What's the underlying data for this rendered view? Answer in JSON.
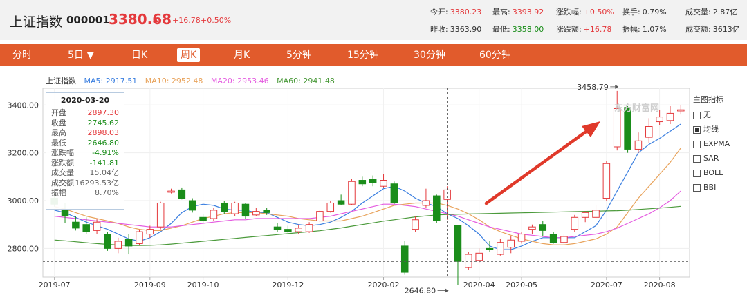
{
  "header": {
    "name": "上证指数",
    "code": "000001",
    "price": "3380.68",
    "change": "+16.78",
    "change_pct": "+0.50%",
    "stats": [
      {
        "label": "今开:",
        "value": "3380.23",
        "color": "red"
      },
      {
        "label": "最高:",
        "value": "3393.92",
        "color": "red"
      },
      {
        "label": "涨跌幅:",
        "value": "+0.50%",
        "color": "red"
      },
      {
        "label": "换手:",
        "value": "0.79%",
        "color": "dark"
      },
      {
        "label": "成交量:",
        "value": "2.87亿",
        "color": "dark"
      },
      {
        "label": "昨收:",
        "value": "3363.90",
        "color": "dark"
      },
      {
        "label": "最低:",
        "value": "3358.00",
        "color": "green"
      },
      {
        "label": "涨跌额:",
        "value": "+16.78",
        "color": "red"
      },
      {
        "label": "振幅:",
        "value": "1.07%",
        "color": "dark"
      },
      {
        "label": "成交额:",
        "value": "3613亿",
        "color": "dark"
      }
    ]
  },
  "tabs": [
    {
      "label": "分时",
      "active": false
    },
    {
      "label": "5日 ▼",
      "active": false
    },
    {
      "label": "日K",
      "active": false
    },
    {
      "label": "周K",
      "active": true
    },
    {
      "label": "月K",
      "active": false
    },
    {
      "label": "5分钟",
      "active": false
    },
    {
      "label": "15分钟",
      "active": false
    },
    {
      "label": "30分钟",
      "active": false
    },
    {
      "label": "60分钟",
      "active": false
    }
  ],
  "legend": {
    "name": "上证指数",
    "ma5": "MA5: 2917.51",
    "ma10": "MA10: 2952.48",
    "ma20": "MA20: 2953.46",
    "ma60": "MA60: 2941.48"
  },
  "tooltip": {
    "date": "2020-03-20",
    "rows": [
      {
        "label": "开盘",
        "value": "2897.30",
        "color": "red"
      },
      {
        "label": "收盘",
        "value": "2745.62",
        "color": "green"
      },
      {
        "label": "最高",
        "value": "2898.03",
        "color": "red"
      },
      {
        "label": "最低",
        "value": "2646.80",
        "color": "green"
      },
      {
        "label": "涨跌幅",
        "value": "-4.91%",
        "color": "green"
      },
      {
        "label": "涨跌额",
        "value": "-141.81",
        "color": "green"
      },
      {
        "label": "成交量",
        "value": "15.04亿",
        "color": "gray"
      },
      {
        "label": "成交额",
        "value": "16293.53亿",
        "color": "gray"
      },
      {
        "label": "振幅",
        "value": "8.70%",
        "color": "gray"
      }
    ]
  },
  "side_panel": {
    "title": "主图指标",
    "options": [
      {
        "label": "无",
        "checked": false
      },
      {
        "label": "均线",
        "checked": true
      },
      {
        "label": "EXPMA",
        "checked": false
      },
      {
        "label": "SAR",
        "checked": false
      },
      {
        "label": "BOLL",
        "checked": false
      },
      {
        "label": "BBI",
        "checked": false
      }
    ]
  },
  "watermark": "东方财富网",
  "colors": {
    "up": "#e4393c",
    "down": "#1a8d1a",
    "accent": "#e15b2c",
    "ma5": "#3b7fe0",
    "ma10": "#e8a25a",
    "ma20": "#e45be0",
    "ma60": "#4b9a3b"
  },
  "chart_data": {
    "type": "candlestick",
    "ylim": [
      2680,
      3470
    ],
    "yticks": [
      "3400.00",
      "3200.00",
      "3000.00",
      "2800.00"
    ],
    "ytick_values": [
      3400,
      3200,
      3000,
      2800
    ],
    "xtick_labels": [
      "2019-07",
      "2019-09",
      "2019-10",
      "2019-12",
      "2020-02",
      "2020-04",
      "2020-05",
      "2020-07",
      "2020-08"
    ],
    "xtick_index": [
      0,
      9,
      14,
      22,
      31,
      40,
      44,
      52,
      57
    ],
    "annotations": [
      {
        "text": "3458.79",
        "index": 53,
        "value": 3458.79
      },
      {
        "text": "2646.80",
        "index": 37,
        "value": 2646.8
      }
    ],
    "crosshair": {
      "index": 37,
      "value": 2745.62
    },
    "candles": [
      [
        3010,
        2985,
        3040,
        2975
      ],
      [
        2960,
        2935,
        2990,
        2905
      ],
      [
        2910,
        2885,
        2935,
        2875
      ],
      [
        2900,
        2870,
        2930,
        2860
      ],
      [
        2875,
        2910,
        2925,
        2860
      ],
      [
        2860,
        2800,
        2870,
        2790
      ],
      [
        2800,
        2830,
        2845,
        2780
      ],
      [
        2840,
        2810,
        2860,
        2775
      ],
      [
        2820,
        2870,
        2880,
        2815
      ],
      [
        2860,
        2880,
        2895,
        2845
      ],
      [
        2890,
        2990,
        2995,
        2880
      ],
      [
        3035,
        3040,
        3050,
        3030
      ],
      [
        3045,
        3010,
        3055,
        3005
      ],
      [
        3000,
        2960,
        3010,
        2950
      ],
      [
        2930,
        2915,
        2945,
        2905
      ],
      [
        2925,
        2960,
        2970,
        2915
      ],
      [
        2990,
        2955,
        3000,
        2945
      ],
      [
        2945,
        2990,
        2995,
        2935
      ],
      [
        2985,
        2935,
        2990,
        2925
      ],
      [
        2940,
        2955,
        2970,
        2935
      ],
      [
        2960,
        2950,
        2970,
        2940
      ],
      [
        2890,
        2880,
        2905,
        2870
      ],
      [
        2880,
        2870,
        2895,
        2865
      ],
      [
        2870,
        2885,
        2900,
        2860
      ],
      [
        2870,
        2900,
        2910,
        2865
      ],
      [
        2915,
        2955,
        2960,
        2910
      ],
      [
        2955,
        2990,
        3000,
        2950
      ],
      [
        3000,
        2985,
        3025,
        2980
      ],
      [
        2985,
        3080,
        3090,
        2980
      ],
      [
        3085,
        3070,
        3100,
        3060
      ],
      [
        3090,
        3075,
        3105,
        3060
      ],
      [
        3060,
        3085,
        3110,
        3055
      ],
      [
        3070,
        2990,
        3080,
        2985
      ],
      [
        2810,
        2700,
        2830,
        2690
      ],
      [
        2880,
        2920,
        2935,
        2870
      ],
      [
        2980,
        3000,
        3050,
        2970
      ],
      [
        3020,
        2915,
        3025,
        2905
      ],
      [
        3005,
        3045,
        3060,
        2920
      ],
      [
        2897.3,
        2745.62,
        2898.03,
        2646.8
      ],
      [
        2720,
        2775,
        2785,
        2710
      ],
      [
        2750,
        2780,
        2800,
        2740
      ],
      [
        2800,
        2795,
        2830,
        2785
      ],
      [
        2775,
        2825,
        2840,
        2770
      ],
      [
        2805,
        2835,
        2850,
        2780
      ],
      [
        2830,
        2860,
        2870,
        2820
      ],
      [
        2880,
        2890,
        2900,
        2860
      ],
      [
        2900,
        2875,
        2915,
        2850
      ],
      [
        2860,
        2825,
        2870,
        2820
      ],
      [
        2825,
        2850,
        2860,
        2815
      ],
      [
        2880,
        2930,
        2940,
        2870
      ],
      [
        2930,
        2950,
        2955,
        2910
      ],
      [
        2930,
        2960,
        2980,
        2925
      ],
      [
        3010,
        3155,
        3165,
        3000
      ],
      [
        3225,
        3385,
        3458.79,
        3210
      ],
      [
        3390,
        3215,
        3395,
        3200
      ],
      [
        3215,
        3250,
        3285,
        3200
      ],
      [
        3265,
        3310,
        3345,
        3240
      ],
      [
        3330,
        3350,
        3380,
        3315
      ],
      [
        3335,
        3365,
        3395,
        3320
      ],
      [
        3375,
        3380,
        3400,
        3360
      ]
    ],
    "series": [
      {
        "name": "MA5",
        "values": [
          2960,
          2950,
          2930,
          2910,
          2895,
          2880,
          2860,
          2840,
          2830,
          2845,
          2870,
          2905,
          2950,
          2975,
          2985,
          2980,
          2965,
          2960,
          2960,
          2950,
          2950,
          2930,
          2910,
          2900,
          2895,
          2900,
          2910,
          2930,
          2955,
          2990,
          3020,
          3050,
          3060,
          3040,
          3010,
          2990,
          2975,
          2945,
          2925,
          2895,
          2860,
          2810,
          2795,
          2795,
          2810,
          2830,
          2845,
          2845,
          2845,
          2845,
          2870,
          2895,
          2960,
          3040,
          3120,
          3200,
          3235,
          3260,
          3290,
          3320
        ]
      },
      {
        "name": "MA10",
        "values": [
          2975,
          2965,
          2950,
          2935,
          2925,
          2915,
          2905,
          2890,
          2880,
          2875,
          2875,
          2885,
          2895,
          2910,
          2925,
          2935,
          2945,
          2950,
          2950,
          2950,
          2945,
          2940,
          2935,
          2925,
          2920,
          2915,
          2915,
          2915,
          2925,
          2935,
          2950,
          2965,
          2980,
          2985,
          2990,
          2990,
          2990,
          2980,
          2965,
          2945,
          2920,
          2890,
          2870,
          2855,
          2840,
          2830,
          2820,
          2815,
          2815,
          2820,
          2830,
          2840,
          2860,
          2890,
          2950,
          3010,
          3060,
          3110,
          3160,
          3220
        ]
      },
      {
        "name": "MA20",
        "values": [
          2935,
          2930,
          2925,
          2920,
          2915,
          2910,
          2905,
          2900,
          2895,
          2890,
          2890,
          2890,
          2895,
          2900,
          2905,
          2910,
          2915,
          2920,
          2920,
          2925,
          2925,
          2925,
          2925,
          2925,
          2925,
          2930,
          2935,
          2945,
          2955,
          2965,
          2975,
          2985,
          2985,
          2980,
          2975,
          2965,
          2955,
          2945,
          2935,
          2920,
          2905,
          2890,
          2880,
          2870,
          2860,
          2855,
          2850,
          2845,
          2845,
          2850,
          2855,
          2860,
          2870,
          2885,
          2905,
          2925,
          2945,
          2970,
          3000,
          3040
        ]
      },
      {
        "name": "MA60",
        "values": [
          2835,
          2832,
          2828,
          2824,
          2820,
          2817,
          2814,
          2812,
          2812,
          2813,
          2815,
          2818,
          2822,
          2826,
          2830,
          2834,
          2838,
          2842,
          2846,
          2850,
          2854,
          2858,
          2862,
          2866,
          2870,
          2874,
          2880,
          2886,
          2893,
          2900,
          2907,
          2914,
          2920,
          2926,
          2932,
          2936,
          2940,
          2942,
          2943,
          2944,
          2945,
          2946,
          2947,
          2948,
          2949,
          2950,
          2951,
          2952,
          2953,
          2954,
          2955,
          2956,
          2957,
          2958,
          2960,
          2963,
          2966,
          2969,
          2972,
          2976
        ]
      }
    ]
  }
}
